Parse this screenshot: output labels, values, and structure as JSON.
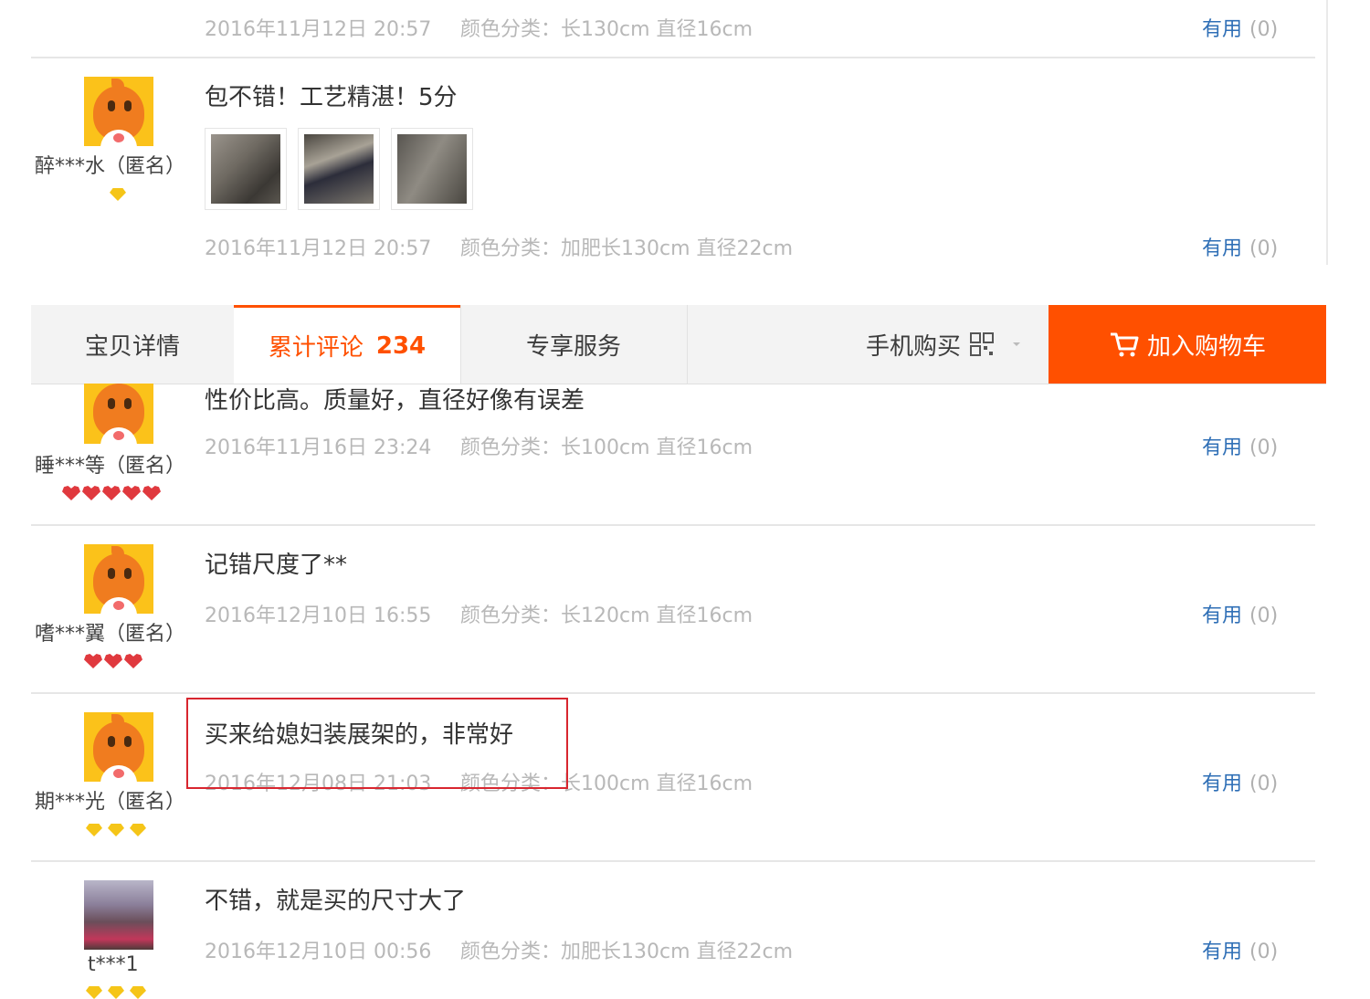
{
  "reviews": [
    {
      "text": "",
      "date": "2016年11月12日 20:57",
      "sku": "颜色分类：长130cm 直径16cm",
      "useful": "有用",
      "count": "(0)"
    },
    {
      "text": "包不错！工艺精湛！5分",
      "date": "2016年11月12日 20:57",
      "sku": "颜色分类：加肥长130cm 直径22cm",
      "useful": "有用",
      "count": "(0)",
      "user": "醉***水（匿名）",
      "badge": "diamond-1"
    },
    {
      "text": "性价比高。质量好，直径好像有误差",
      "date": "2016年11月16日 23:24",
      "sku": "颜色分类：长100cm 直径16cm",
      "useful": "有用",
      "count": "(0)",
      "user": "睡***等（匿名）",
      "badge": "heart-5"
    },
    {
      "text": "记错尺度了**",
      "date": "2016年12月10日 16:55",
      "sku": "颜色分类：长120cm 直径16cm",
      "useful": "有用",
      "count": "(0)",
      "user": "嗜***翼（匿名）",
      "badge": "heart-3"
    },
    {
      "text": "买来给媳妇装展架的，非常好",
      "date": "2016年12月08日 21:03",
      "sku": "颜色分类：长100cm 直径16cm",
      "useful": "有用",
      "count": "(0)",
      "user": "期***光（匿名）",
      "badge": "diamond-3"
    },
    {
      "text": "不错，就是买的尺寸大了",
      "date": "2016年12月10日 00:56",
      "sku": "颜色分类：加肥长130cm 直径22cm",
      "useful": "有用",
      "count": "(0)",
      "user": "t***1",
      "badge": "diamond-3"
    }
  ],
  "tabs": {
    "details": "宝贝详情",
    "reviews": "累计评论",
    "reviews_count": "234",
    "service": "专享服务",
    "mobile": "手机购买",
    "cart": "加入购物车"
  },
  "colors": {
    "accent": "#ff5000",
    "link": "#2f6fb6",
    "highlight": "#d8262f"
  }
}
